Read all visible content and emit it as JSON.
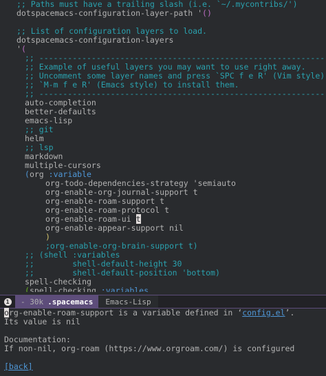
{
  "editor": {
    "lines": [
      {
        "segments": [
          {
            "t": ";; Paths must have a trailing slash (i.e. `~/.mycontribs/')",
            "c": "c-comment"
          }
        ],
        "indent": 2
      },
      {
        "segments": [
          {
            "t": "dotspacemacs-configuration-layer-path '",
            "c": "c-default"
          },
          {
            "t": "()",
            "c": "c-paren"
          }
        ],
        "indent": 2
      },
      {
        "segments": [],
        "indent": 0
      },
      {
        "segments": [
          {
            "t": ";; List of configuration layers to load.",
            "c": "c-comment"
          }
        ],
        "indent": 2
      },
      {
        "segments": [
          {
            "t": "dotspacemacs-configuration-layers",
            "c": "c-default"
          }
        ],
        "indent": 2
      },
      {
        "segments": [
          {
            "t": "'",
            "c": "c-default"
          },
          {
            "t": "(",
            "c": "c-paren"
          }
        ],
        "indent": 2
      },
      {
        "segments": [
          {
            "t": ";; ----------------------------------------------------------------",
            "c": "c-comment"
          }
        ],
        "indent": 4
      },
      {
        "segments": [
          {
            "t": ";; Example of useful layers you may want to use right away.",
            "c": "c-comment"
          }
        ],
        "indent": 4
      },
      {
        "segments": [
          {
            "t": ";; Uncomment some layer names and press `SPC f e R' (Vim style) or",
            "c": "c-comment"
          }
        ],
        "indent": 4
      },
      {
        "segments": [
          {
            "t": ";; `M-m f e R' (Emacs style) to install them.",
            "c": "c-comment"
          }
        ],
        "indent": 4
      },
      {
        "segments": [
          {
            "t": ";; ----------------------------------------------------------------",
            "c": "c-comment"
          }
        ],
        "indent": 4
      },
      {
        "segments": [
          {
            "t": "auto-completion",
            "c": "c-default"
          }
        ],
        "indent": 4
      },
      {
        "segments": [
          {
            "t": "better-defaults",
            "c": "c-default"
          }
        ],
        "indent": 4
      },
      {
        "segments": [
          {
            "t": "emacs-lisp",
            "c": "c-default"
          }
        ],
        "indent": 4
      },
      {
        "segments": [
          {
            "t": ";; git",
            "c": "c-comment"
          }
        ],
        "indent": 4
      },
      {
        "segments": [
          {
            "t": "helm",
            "c": "c-default"
          }
        ],
        "indent": 4
      },
      {
        "segments": [
          {
            "t": ";; lsp",
            "c": "c-comment"
          }
        ],
        "indent": 4
      },
      {
        "segments": [
          {
            "t": "markdown",
            "c": "c-default"
          }
        ],
        "indent": 4
      },
      {
        "segments": [
          {
            "t": "multiple-cursors",
            "c": "c-default"
          }
        ],
        "indent": 4
      },
      {
        "segments": [
          {
            "t": "(",
            "c": "c-paren2"
          },
          {
            "t": "org ",
            "c": "c-default"
          },
          {
            "t": ":variable",
            "c": "c-keyword"
          }
        ],
        "indent": 4
      },
      {
        "segments": [
          {
            "t": "org-todo-dependencies-strategy 'semiauto",
            "c": "c-default"
          }
        ],
        "indent": 9
      },
      {
        "segments": [
          {
            "t": "org-enable-org-journal-support t",
            "c": "c-default"
          }
        ],
        "indent": 9
      },
      {
        "segments": [
          {
            "t": "org-enable-roam-support t",
            "c": "c-default"
          }
        ],
        "indent": 9
      },
      {
        "segments": [
          {
            "t": "org-enable-roam-protocol t",
            "c": "c-default"
          }
        ],
        "indent": 9
      },
      {
        "segments": [
          {
            "t": "org-enable-roam-ui ",
            "c": "c-default"
          },
          {
            "t": "t",
            "c": "cursor"
          }
        ],
        "indent": 9
      },
      {
        "segments": [
          {
            "t": "org-enable-appear-support nil",
            "c": "c-default"
          }
        ],
        "indent": 9
      },
      {
        "segments": [
          {
            "t": ")",
            "c": "c-yellow"
          }
        ],
        "indent": 9
      },
      {
        "segments": [
          {
            "t": ";org-enable-org-brain-support t)",
            "c": "c-comment"
          }
        ],
        "indent": 9
      },
      {
        "segments": [
          {
            "t": ";; (shell :variables",
            "c": "c-comment"
          }
        ],
        "indent": 4
      },
      {
        "segments": [
          {
            "t": ";;        shell-default-height 30",
            "c": "c-comment"
          }
        ],
        "indent": 4
      },
      {
        "segments": [
          {
            "t": ";;        shell-default-position 'bottom)",
            "c": "c-comment"
          }
        ],
        "indent": 4
      },
      {
        "segments": [
          {
            "t": "spell-checking",
            "c": "c-default"
          }
        ],
        "indent": 4
      },
      {
        "segments": [
          {
            "t": "(",
            "c": "c-paren3"
          },
          {
            "t": "spell-checking ",
            "c": "c-default"
          },
          {
            "t": ":variables",
            "c": "c-keyword"
          }
        ],
        "indent": 4
      }
    ]
  },
  "modeline": {
    "window_number": "1",
    "position": "- 30k",
    "buffer_name": ".spacemacs",
    "major_mode": "Emacs-Lisp"
  },
  "help": {
    "cursor_char": "o",
    "line1_rest": "rg-enable-roam-support is a variable defined in ‘",
    "line1_link": "config.el",
    "line1_end": "’.",
    "line2": "Its value is nil",
    "line4": "Documentation:",
    "line5": "If non-nil, org-roam (https://www.orgroam.com/) is configured",
    "back_label": "[back]"
  },
  "colors": {
    "background": "#292b2e",
    "comment": "#2aa1ae",
    "keyword": "#4f97d7",
    "paren": "#bc6ec5",
    "modeline_accent": "#5d4d7a"
  }
}
